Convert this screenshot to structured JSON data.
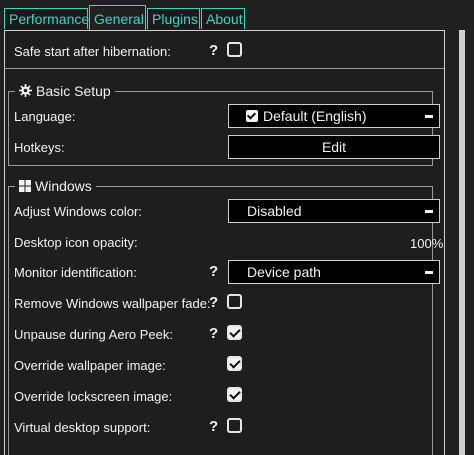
{
  "tabs": [
    {
      "label": "Performance"
    },
    {
      "label": "General"
    },
    {
      "label": "Plugins"
    },
    {
      "label": "About"
    }
  ],
  "help_glyph": "?",
  "top": {
    "safe_start_label": "Safe start after hibernation:",
    "safe_start_checked": false
  },
  "basic_setup": {
    "title": "Basic Setup",
    "icon": "gear-icon",
    "language_label": "Language:",
    "language_value": "Default (English)",
    "hotkeys_label": "Hotkeys:",
    "hotkeys_button": "Edit"
  },
  "windows": {
    "title": "Windows",
    "icon": "windows-logo-icon",
    "adjust_color_label": "Adjust Windows color:",
    "adjust_color_value": "Disabled",
    "desktop_icon_opacity_label": "Desktop icon opacity:",
    "desktop_icon_opacity_value": "100%",
    "monitor_id_label": "Monitor identification:",
    "monitor_id_value": "Device path",
    "remove_wallpaper_fade_label": "Remove Windows wallpaper fade:",
    "remove_wallpaper_fade_checked": false,
    "unpause_aero_peek_label": "Unpause during Aero Peek:",
    "unpause_aero_peek_checked": true,
    "override_wallpaper_label": "Override wallpaper image:",
    "override_wallpaper_checked": true,
    "override_lockscreen_label": "Override lockscreen image:",
    "override_lockscreen_checked": true,
    "virtual_desktop_label": "Virtual desktop support:",
    "virtual_desktop_checked": false
  },
  "colors": {
    "accent": "#3fd3c4",
    "background": "#1e1e1e",
    "text": "#f2f2f2"
  }
}
